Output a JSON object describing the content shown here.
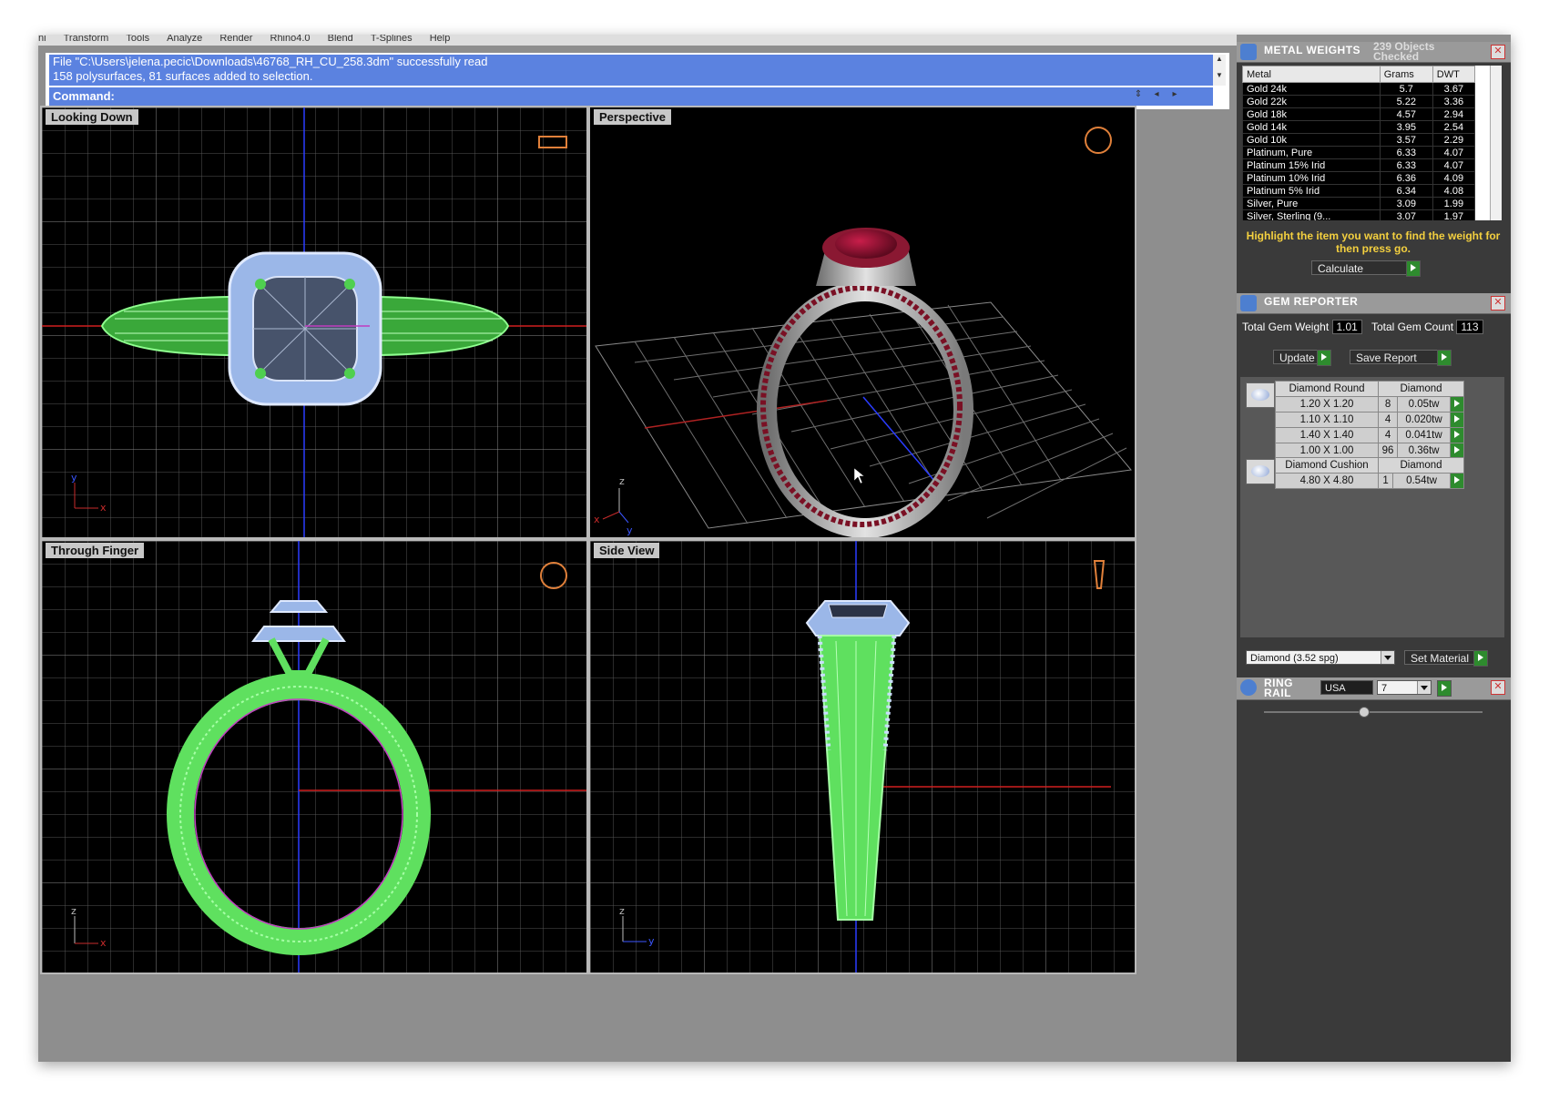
{
  "menu": [
    "ni",
    "Transform",
    "Tools",
    "Analyze",
    "Render",
    "Rhino4.0",
    "Blend",
    "T-Splines",
    "Help"
  ],
  "command": {
    "history_line1": "File \"C:\\Users\\jelena.pecic\\Downloads\\46768_RH_CU_258.3dm\" successfully read",
    "history_line2": "158 polysurfaces, 81 surfaces added to selection.",
    "prompt": "Command:"
  },
  "viewports": {
    "top_left": "Looking Down",
    "top_right": "Perspective",
    "bottom_left": "Through Finger",
    "bottom_right": "Side View"
  },
  "axis_labels": {
    "x": "x",
    "y": "y",
    "z": "z"
  },
  "metal_weights": {
    "title": "METAL WEIGHTS",
    "status": "239 Objects Checked",
    "columns": [
      "Metal",
      "Grams",
      "DWT"
    ],
    "rows": [
      [
        "Gold 24k",
        "5.7",
        "3.67"
      ],
      [
        "Gold 22k",
        "5.22",
        "3.36"
      ],
      [
        "Gold 18k",
        "4.57",
        "2.94"
      ],
      [
        "Gold 14k",
        "3.95",
        "2.54"
      ],
      [
        "Gold 10k",
        "3.57",
        "2.29"
      ],
      [
        "Platinum, Pure",
        "6.33",
        "4.07"
      ],
      [
        "Platinum 15% Irid",
        "6.33",
        "4.07"
      ],
      [
        "Platinum 10% Irid",
        "6.36",
        "4.09"
      ],
      [
        "Platinum 5% Irid",
        "6.34",
        "4.08"
      ],
      [
        "Silver, Pure",
        "3.09",
        "1.99"
      ],
      [
        "Silver, Sterling (9...",
        "3.07",
        "1.97"
      ]
    ],
    "hint": "Highlight the item you want to find the weight for then press go.",
    "calculate_label": "Calculate"
  },
  "gem_reporter": {
    "title": "GEM REPORTER",
    "total_weight_label": "Total Gem Weight",
    "total_weight": "1.01",
    "total_count_label": "Total Gem Count",
    "total_count": "113",
    "update_label": "Update",
    "save_label": "Save Report",
    "groups": [
      {
        "shape": "Diamond Round",
        "material": "Diamond",
        "rows": [
          [
            "1.20 X 1.20",
            "8",
            "0.05tw"
          ],
          [
            "1.10 X 1.10",
            "4",
            "0.020tw"
          ],
          [
            "1.40 X 1.40",
            "4",
            "0.041tw"
          ],
          [
            "1.00 X 1.00",
            "96",
            "0.36tw"
          ]
        ]
      },
      {
        "shape": "Diamond Cushion",
        "material": "Diamond",
        "rows": [
          [
            "4.80 X 4.80",
            "1",
            "0.54tw"
          ]
        ]
      }
    ],
    "material_select": "Diamond    (3.52 spg)",
    "set_material_label": "Set Material"
  },
  "ring_rail": {
    "title_line1": "RING",
    "title_line2": "RAIL",
    "region": "USA",
    "size": "7"
  }
}
